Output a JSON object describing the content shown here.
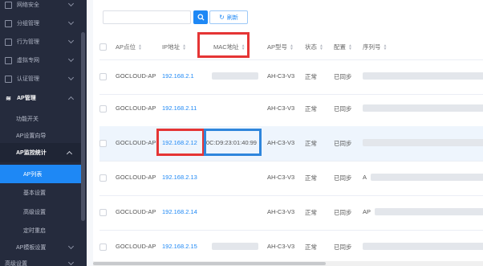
{
  "sidebar": {
    "top_items": [
      {
        "label": "网络安全",
        "icon": "shield-icon"
      },
      {
        "label": "分组管理",
        "icon": "group-icon"
      },
      {
        "label": "行为管理",
        "icon": "edit-icon"
      },
      {
        "label": "虚拟专网",
        "icon": "network-icon"
      },
      {
        "label": "认证管理",
        "icon": "id-card-icon"
      }
    ],
    "ap_manage": {
      "label": "AP管理",
      "icon": "wifi-icon"
    },
    "sub_items": [
      "功能开关",
      "AP设置向导"
    ],
    "ap_monitor": {
      "label": "AP监控统计"
    },
    "monitor_children": [
      "AP列表",
      "基本设置",
      "高级设置",
      "定时重启"
    ],
    "bottom_items": [
      "AP模板设置",
      "高级设置"
    ]
  },
  "toolbar": {
    "search_value": "",
    "refresh_label": "刷新"
  },
  "table": {
    "headers": [
      "AP点位",
      "IP地址",
      "MAC地址",
      "AP型号",
      "状态",
      "配置",
      "序列号"
    ],
    "rows": [
      {
        "site": "GOCLOUD-AP",
        "ip": "192.168.2.1",
        "mac": "",
        "model": "AH-C3-V3",
        "status": "正常",
        "config": "已同步",
        "serial": ""
      },
      {
        "site": "GOCLOUD-AP",
        "ip": "192.168.2.11",
        "mac": "",
        "model": "AH-C3-V3",
        "status": "正常",
        "config": "已同步",
        "serial": ""
      },
      {
        "site": "GOCLOUD-AP",
        "ip": "192.168.2.12",
        "mac": "0C:D9:23:01:40:99",
        "model": "AH-C3-V3",
        "status": "正常",
        "config": "已同步",
        "serial": ""
      },
      {
        "site": "GOCLOUD-AP",
        "ip": "192.168.2.13",
        "mac": "",
        "model": "AH-C3-V3",
        "status": "正常",
        "config": "已同步",
        "serial": "A"
      },
      {
        "site": "GOCLOUD-AP",
        "ip": "192.168.2.14",
        "mac": "",
        "model": "AH-C3-V3",
        "status": "正常",
        "config": "已同步",
        "serial": "AP"
      },
      {
        "site": "GOCLOUD-AP",
        "ip": "192.168.2.15",
        "mac": "",
        "model": "AH-C3-V3",
        "status": "正常",
        "config": "已同步",
        "serial": ""
      }
    ]
  },
  "colors": {
    "accent": "#1e88f5",
    "highlight_red": "#e53535",
    "highlight_blue": "#2f86dc",
    "sidebar_bg": "#252b3d"
  }
}
